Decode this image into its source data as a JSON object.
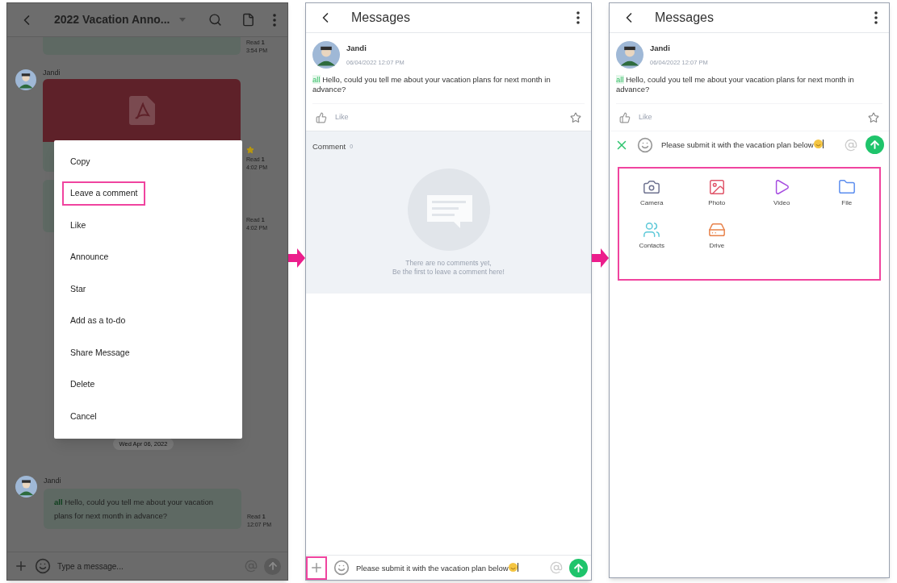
{
  "chat_screen": {
    "title": "2022 Vacation Anno...",
    "messages": [
      {
        "kind": "partial",
        "starred": false,
        "read_label": "Read **1**",
        "time": "3:54 PM"
      },
      {
        "kind": "file",
        "sender": "Jandi",
        "starred": true,
        "read_label": "Read **1**",
        "time": "4:02 PM"
      },
      {
        "kind": "partial",
        "starred": false,
        "read_label": "Read **1**",
        "time": "4:02 PM"
      }
    ],
    "date_chip": "Wed Apr 06, 2022",
    "last_message": {
      "sender": "Jandi",
      "mention": "all",
      "text": "Hello, could you tell me about your vacation plans for next month in advance?",
      "read_label": "Read **1**",
      "time": "12:07 PM"
    },
    "composer": {
      "placeholder": "Type a message..."
    },
    "context_menu": [
      {
        "label": "Copy",
        "highlighted": false
      },
      {
        "label": "Leave a comment",
        "highlighted": true
      },
      {
        "label": "Like",
        "highlighted": false
      },
      {
        "label": "Announce",
        "highlighted": false
      },
      {
        "label": "Star",
        "highlighted": false
      },
      {
        "label": "Add as a to-do",
        "highlighted": false
      },
      {
        "label": "Share Message",
        "highlighted": false
      },
      {
        "label": "Delete",
        "highlighted": false
      },
      {
        "label": "Cancel",
        "highlighted": false
      }
    ]
  },
  "message_screen": {
    "title": "Messages",
    "post": {
      "sender": "Jandi",
      "datetime": "06/04/2022 12:07 PM",
      "mention": "all",
      "text": "Hello, could you tell me about your vacation plans for next month in advance?",
      "like_label": "Like",
      "starred": false
    },
    "comments": {
      "label": "Comment",
      "count": "0",
      "empty_lines": [
        "There are no comments yet,",
        "Be the first to leave a comment here!"
      ]
    },
    "composer": {
      "value": "Please submit it with the vacation plan below",
      "plus_highlighted": true
    }
  },
  "attach_screen": {
    "title": "Messages",
    "post": {
      "sender": "Jandi",
      "datetime": "06/04/2022 12:07 PM",
      "mention": "all",
      "text": "Hello, could you tell me about your vacation plans for next month in advance?",
      "like_label": "Like",
      "starred": false
    },
    "composer": {
      "value": "Please submit it with the vacation plan below"
    },
    "attachments": [
      {
        "kind": "camera",
        "label": "Camera"
      },
      {
        "kind": "photo",
        "label": "Photo"
      },
      {
        "kind": "video",
        "label": "Video"
      },
      {
        "kind": "file",
        "label": "File"
      },
      {
        "kind": "contacts",
        "label": "Contacts"
      },
      {
        "kind": "drive",
        "label": "Drive"
      }
    ]
  }
}
